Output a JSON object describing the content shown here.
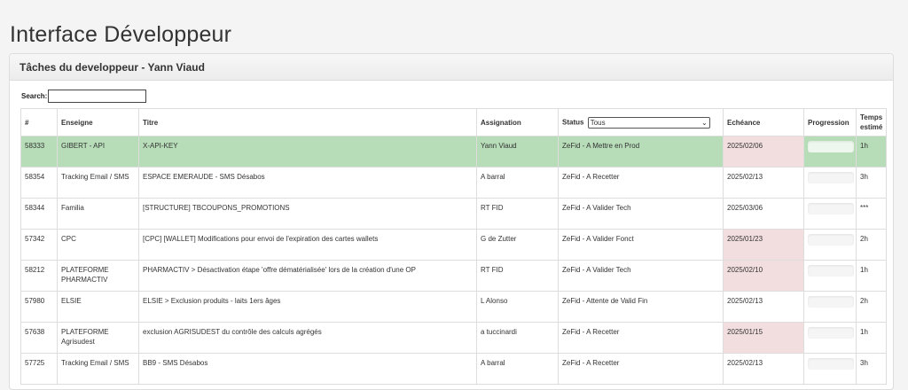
{
  "page": {
    "title": "Interface Développeur"
  },
  "panel": {
    "heading": "Tâches du developpeur - Yann Viaud"
  },
  "search": {
    "label": "Search:",
    "value": ""
  },
  "table": {
    "headers": {
      "id": "#",
      "enseigne": "Enseigne",
      "titre": "Titre",
      "assignation": "Assignation",
      "status": "Status",
      "echeance": "Echéance",
      "progression": "Progression",
      "temps": "Temps estimé"
    },
    "status_filter": "Tous",
    "rows": [
      {
        "id": "58333",
        "enseigne": "GIBERT - API",
        "titre": "X-API-KEY",
        "assignation": "Yann Viaud",
        "status": "ZeFid - A Mettre en Prod",
        "echeance": "2025/02/06",
        "late": true,
        "progress": 0,
        "temps": "1h",
        "highlight": true
      },
      {
        "id": "58354",
        "enseigne": "Tracking Email / SMS",
        "titre": "ESPACE EMERAUDE - SMS Désabos",
        "assignation": "A        barral",
        "status": "ZeFid - A Recetter",
        "echeance": "2025/02/13",
        "late": false,
        "progress": 0,
        "temps": "3h",
        "highlight": false
      },
      {
        "id": "58344",
        "enseigne": "Familia",
        "titre": "[STRUCTURE] TBCOUPONS_PROMOTIONS",
        "assignation": "RT FID",
        "status": "ZeFid - A Valider Tech",
        "echeance": "2025/03/06",
        "late": false,
        "progress": 0,
        "temps": "***",
        "highlight": false
      },
      {
        "id": "57342",
        "enseigne": "CPC",
        "titre": "[CPC] [WALLET] Modifications pour envoi de l'expiration des cartes wallets",
        "assignation": "G           de Zutter",
        "status": "ZeFid - A Valider Fonct",
        "echeance": "2025/01/23",
        "late": true,
        "progress": 0,
        "temps": "2h",
        "highlight": false
      },
      {
        "id": "58212",
        "enseigne": "PLATEFORME PHARMACTIV",
        "titre": "PHARMACTIV > Désactivation étape 'offre dématérialisée' lors de la création d'une OP",
        "assignation": "RT FID",
        "status": "ZeFid - A Valider Tech",
        "echeance": "2025/02/10",
        "late": true,
        "progress": 0,
        "temps": "1h",
        "highlight": false
      },
      {
        "id": "57980",
        "enseigne": "ELSIE",
        "titre": "ELSIE > Exclusion produits - laits 1ers âges",
        "assignation": "L     Alonso",
        "status": "ZeFid - Attente de Valid Fin",
        "echeance": "2025/02/13",
        "late": false,
        "progress": 0,
        "temps": "2h",
        "highlight": false
      },
      {
        "id": "57638",
        "enseigne": "PLATEFORME Agrisudest",
        "titre": "exclusion AGRISUDEST du contrôle des calculs agrégés",
        "assignation": "a        tuccinardi",
        "status": "ZeFid - A Recetter",
        "echeance": "2025/01/15",
        "late": true,
        "progress": 0,
        "temps": "1h",
        "highlight": false
      },
      {
        "id": "57725",
        "enseigne": "Tracking Email / SMS",
        "titre": "BB9 - SMS Désabos",
        "assignation": "A        barral",
        "status": "ZeFid - A Recetter",
        "echeance": "2025/02/13",
        "late": false,
        "progress": 0,
        "temps": "3h",
        "highlight": false
      }
    ]
  }
}
